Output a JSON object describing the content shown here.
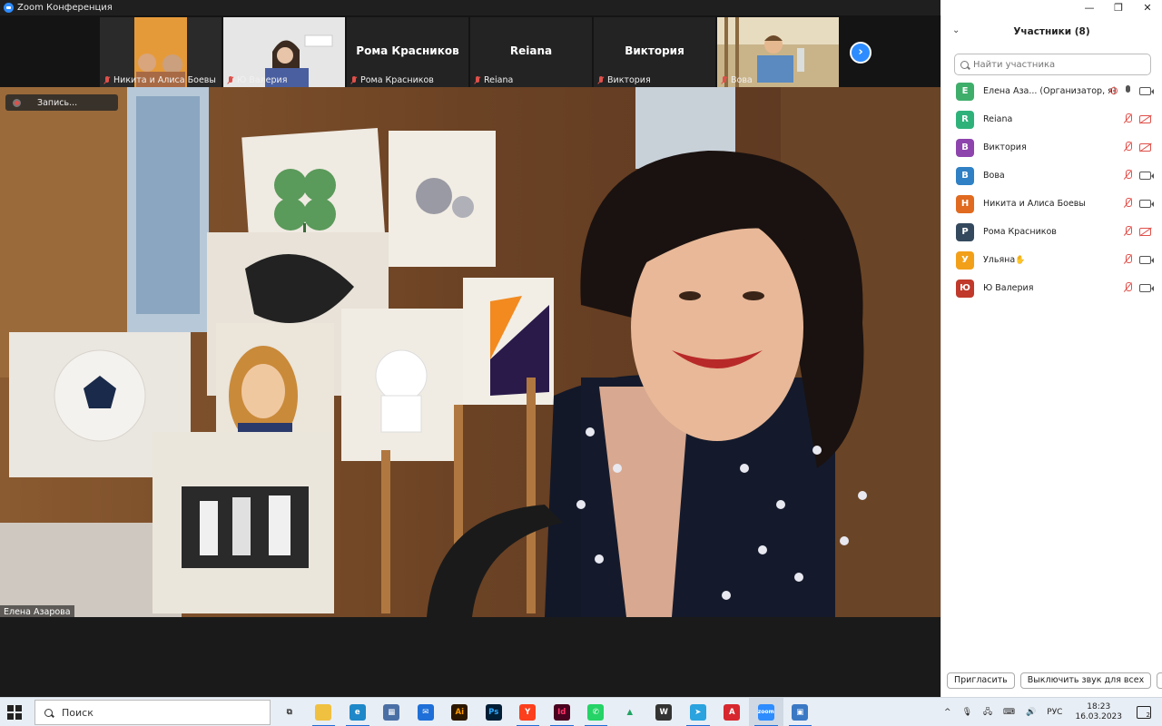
{
  "window": {
    "title": "Zoom Конференция",
    "controls": [
      "—",
      "❐",
      "✕"
    ]
  },
  "strip": {
    "tiles": [
      {
        "name": "Никита и Алиса Боевы",
        "video": true
      },
      {
        "name": "Ю Валерия",
        "video": true
      },
      {
        "name": "Рома Красников",
        "video": false
      },
      {
        "name": "Reiana",
        "video": false
      },
      {
        "name": "Виктория",
        "video": false
      },
      {
        "name": "Вова",
        "video": true
      }
    ],
    "next_label": "›"
  },
  "recording": {
    "label": "Запись..."
  },
  "speaker": {
    "name": "Елена Азарова"
  },
  "panel": {
    "title": "Участники (8)",
    "search_placeholder": "Найти участника",
    "participants": [
      {
        "initial": "Е",
        "name": "Елена Аза...  (Организатор, я)",
        "color": "#3fae6b",
        "mic": "on",
        "cam": "on",
        "host": true
      },
      {
        "initial": "R",
        "name": "Reiana",
        "color": "#2fb27a",
        "mic": "muted",
        "cam": "off"
      },
      {
        "initial": "В",
        "name": "Виктория",
        "color": "#8e44ad",
        "mic": "muted",
        "cam": "off"
      },
      {
        "initial": "В",
        "name": "Вова",
        "color": "#2f80c4",
        "mic": "muted",
        "cam": "on"
      },
      {
        "initial": "Н",
        "name": "Никита и Алиса Боевы",
        "color": "#e06a1f",
        "mic": "muted",
        "cam": "on"
      },
      {
        "initial": "Р",
        "name": "Рома Красников",
        "color": "#34495e",
        "mic": "muted",
        "cam": "off"
      },
      {
        "initial": "У",
        "name": "Ульяна",
        "color": "#f2a01a",
        "mic": "muted",
        "cam": "on",
        "hand": "✋"
      },
      {
        "initial": "Ю",
        "name": "Ю Валерия",
        "color": "#c0392b",
        "mic": "muted",
        "cam": "on"
      }
    ],
    "invite_label": "Пригласить",
    "mute_all_label": "Выключить звук для всех",
    "more_label": "···"
  },
  "taskbar": {
    "search_label": "Поиск",
    "apps": [
      {
        "name": "task-view",
        "label": "⧉",
        "color": "transparent",
        "fg": "#333"
      },
      {
        "name": "file-explorer",
        "label": "",
        "color": "#f0c040",
        "fg": "#fff"
      },
      {
        "name": "edge",
        "label": "e",
        "color": "#1e88c8",
        "fg": "#fff"
      },
      {
        "name": "calculator",
        "label": "▦",
        "color": "#4a6fa5",
        "fg": "#fff"
      },
      {
        "name": "mail",
        "label": "✉",
        "color": "#1e6fd8",
        "fg": "#fff"
      },
      {
        "name": "illustrator",
        "label": "Ai",
        "color": "#2b1700",
        "fg": "#ff9a00"
      },
      {
        "name": "photoshop",
        "label": "Ps",
        "color": "#001e36",
        "fg": "#31a8ff"
      },
      {
        "name": "yandex",
        "label": "Y",
        "color": "#fc3f1d",
        "fg": "#fff"
      },
      {
        "name": "indesign",
        "label": "Id",
        "color": "#49021f",
        "fg": "#ff3366"
      },
      {
        "name": "whatsapp",
        "label": "✆",
        "color": "#25d366",
        "fg": "#fff"
      },
      {
        "name": "google-drive",
        "label": "▲",
        "color": "transparent",
        "fg": "#1fa463"
      },
      {
        "name": "word-app",
        "label": "W",
        "color": "#333",
        "fg": "#fff"
      },
      {
        "name": "telegram",
        "label": "➤",
        "color": "#2aa3df",
        "fg": "#fff"
      },
      {
        "name": "acrobat",
        "label": "A",
        "color": "#d7282f",
        "fg": "#fff"
      },
      {
        "name": "zoom",
        "label": "zoom",
        "color": "#2d8cff",
        "fg": "#fff"
      },
      {
        "name": "photos",
        "label": "▣",
        "color": "#3a78c4",
        "fg": "#fff"
      }
    ],
    "tray": {
      "chevron": "^",
      "language": "РУС",
      "time": "18:23",
      "date": "16.03.2023",
      "notifications": "2"
    }
  }
}
